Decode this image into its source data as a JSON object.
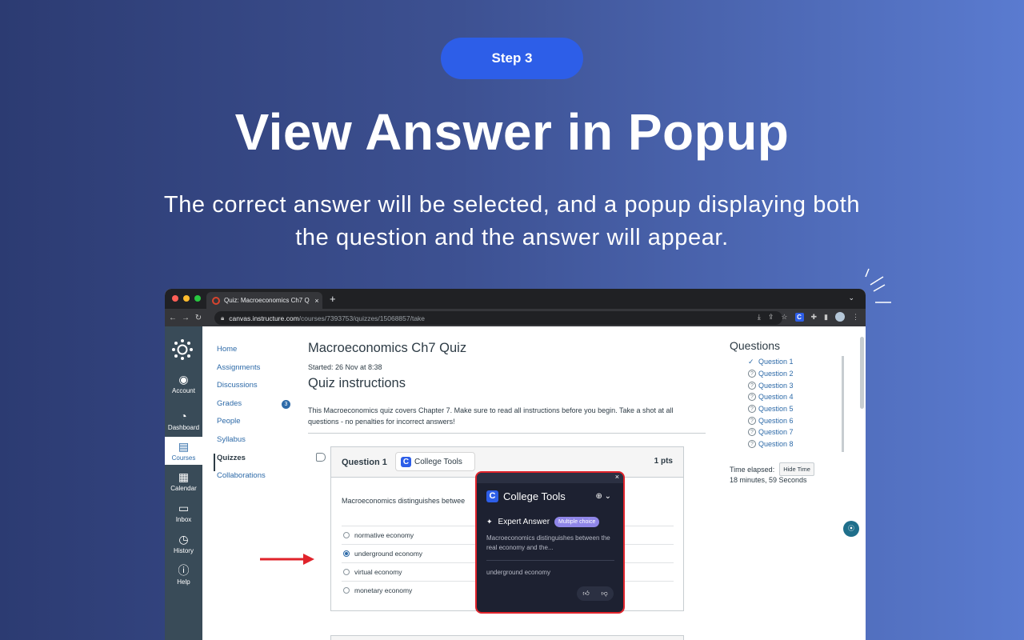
{
  "hero": {
    "step": "Step 3",
    "title": "View Answer in Popup",
    "subtitle": "The correct answer will be selected, and a popup displaying both the question and the answer will appear."
  },
  "browser": {
    "tab_title": "Quiz: Macroeconomics Ch7 Q",
    "tab_close": "×",
    "new_tab": "+",
    "url_host": "canvas.instructure.com",
    "url_path": "/courses/7393753/quizzes/15068857/take"
  },
  "global_nav": [
    {
      "label": "Account",
      "icon": "account-icon"
    },
    {
      "label": "Dashboard",
      "icon": "dashboard-icon"
    },
    {
      "label": "Courses",
      "icon": "courses-icon"
    },
    {
      "label": "Calendar",
      "icon": "calendar-icon"
    },
    {
      "label": "Inbox",
      "icon": "inbox-icon"
    },
    {
      "label": "History",
      "icon": "history-icon"
    },
    {
      "label": "Help",
      "icon": "help-icon"
    }
  ],
  "course_nav": [
    "Home",
    "Assignments",
    "Discussions",
    "Grades",
    "People",
    "Syllabus",
    "Quizzes",
    "Collaborations"
  ],
  "grades_badge": "3",
  "quiz": {
    "title": "Macroeconomics Ch7 Quiz",
    "started": "Started: 26 Nov at 8:38",
    "instructions_heading": "Quiz instructions",
    "instructions": "This Macroeconomics quiz covers Chapter 7. Make sure to read all instructions before you begin. Take a shot at all questions - no penalties for incorrect answers!",
    "question_label": "Question 1",
    "points": "1 pts",
    "college_tools_label": "College Tools",
    "question_text": "Macroeconomics distinguishes betwee",
    "answers": [
      "normative economy",
      "underground economy",
      "virtual economy",
      "monetary economy"
    ],
    "selected_answer_index": 1
  },
  "popup": {
    "close": "×",
    "brand": "College Tools",
    "expert_label": "Expert Answer",
    "type_badge": "Multiple choice",
    "question_preview": "Macroeconomics distinguishes between the real economy and the...",
    "answer": "underground economy"
  },
  "sidebar": {
    "title": "Questions",
    "questions": [
      "Question 1",
      "Question 2",
      "Question 3",
      "Question 4",
      "Question 5",
      "Question 6",
      "Question 7",
      "Question 8"
    ],
    "time_label": "Time elapsed:",
    "hide_time": "Hide Time",
    "elapsed": "18 minutes, 59 Seconds"
  },
  "colors": {
    "accent": "#2d5ee8",
    "canvas_nav": "#394b58",
    "popup_border": "#e0232b",
    "link": "#2d6aa8"
  }
}
